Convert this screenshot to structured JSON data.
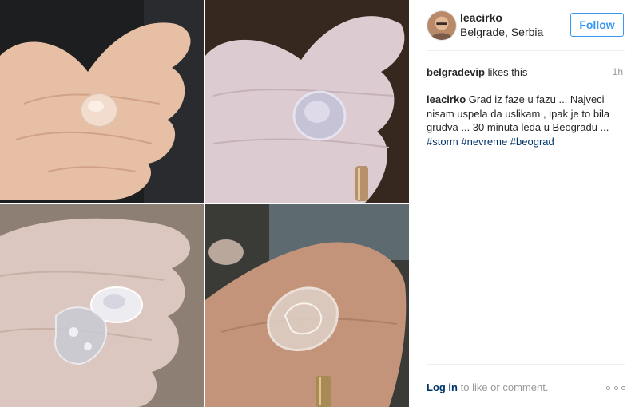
{
  "post": {
    "photos": [
      {
        "name": "photo-hailstone-palm",
        "bg": "#1d1e20"
      },
      {
        "name": "photo-hailstone-closeup",
        "bg": "#36281f"
      },
      {
        "name": "photo-hailstones-fingers",
        "bg": "#8d7f73"
      },
      {
        "name": "photo-hailstone-cluster",
        "bg": "#3a3a37"
      }
    ]
  },
  "header": {
    "username": "leacirko",
    "location": "Belgrade, Serbia",
    "follow_label": "Follow"
  },
  "likes": {
    "liker": "belgradevip",
    "suffix": " likes this",
    "time": "1h"
  },
  "caption": {
    "username": "leacirko",
    "text": " Grad iz faze u fazu ... Najveci nisam uspela da uslikam , ipak je to bila grudva ... 30 minuta leda u Beogradu ... ",
    "hashtags": [
      "#storm",
      "#nevreme",
      "#beograd"
    ]
  },
  "footer": {
    "login_label": "Log in",
    "suffix": " to like or comment."
  },
  "colors": {
    "link_blue": "#003569",
    "button_blue": "#3897f0",
    "muted": "#999999"
  }
}
